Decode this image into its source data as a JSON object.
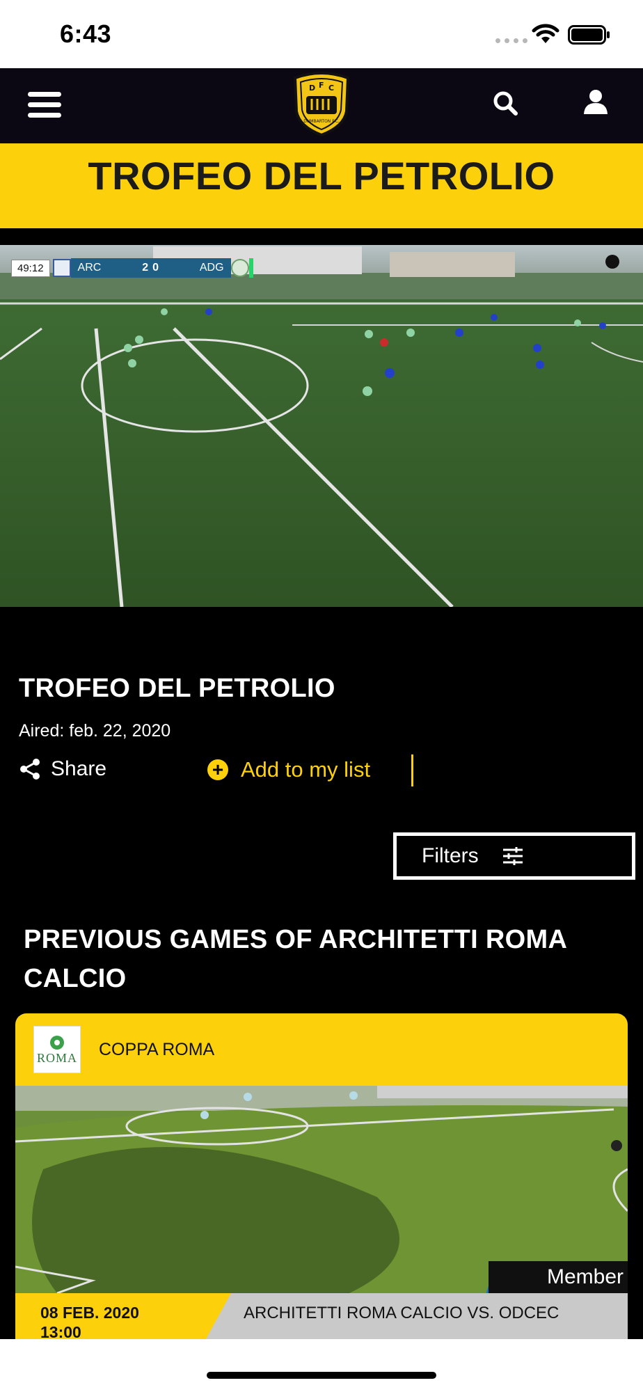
{
  "status_bar": {
    "time": "6:43"
  },
  "header": {
    "logo_text_top": "D F C",
    "logo_text_bottom": "DUMBARTON F.C."
  },
  "banner": {
    "title": "TROFEO DEL PETROLIO"
  },
  "video": {
    "scoreboard": {
      "clock": "49:12",
      "home": "ARC",
      "home_score": "2",
      "away_score": "0",
      "away": "ADG"
    }
  },
  "details": {
    "title": "TROFEO DEL PETROLIO",
    "aired": "Aired: feb. 22, 2020",
    "share_label": "Share",
    "add_list_label": "Add to my list"
  },
  "filters": {
    "label": "Filters"
  },
  "previous": {
    "title": "PREVIOUS GAMES OF ARCHITETTI ROMA CALCIO",
    "cards": [
      {
        "competition": "COPPA ROMA",
        "competition_logo_text": "ROMA",
        "badge": "Member",
        "date": "08 FEB. 2020",
        "time": "13:00",
        "match": "ARCHITETTI ROMA CALCIO VS. ODCEC"
      }
    ]
  },
  "colors": {
    "accent": "#fcd10c",
    "navbar": "#0b0814",
    "background": "#000000",
    "badge_stripe": "#1f6fd0"
  }
}
